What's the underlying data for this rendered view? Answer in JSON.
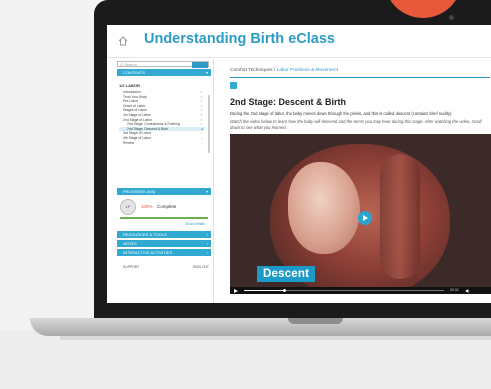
{
  "app": {
    "title": "Understanding Birth eClass"
  },
  "sidebar": {
    "search_placeholder": "Q Search",
    "sections": {
      "contents": "CONTENTS",
      "progress": "PROGRESS (5/8)",
      "resources": "RESOURCES & TOOLS",
      "notes": "NOTES",
      "interactive": "INTERACTIVE ACTIVITIES"
    },
    "toc_head": "1/2 LABOR",
    "toc": [
      {
        "label": "Introduction",
        "sub": false,
        "done": true,
        "active": false
      },
      {
        "label": "Trust Your Body",
        "sub": false,
        "done": true,
        "active": false
      },
      {
        "label": "Pre-Labor",
        "sub": false,
        "done": true,
        "active": false
      },
      {
        "label": "Onset of Labor",
        "sub": false,
        "done": true,
        "active": false
      },
      {
        "label": "Stages of Labor",
        "sub": false,
        "done": true,
        "active": false
      },
      {
        "label": "1st Stage of Labor",
        "sub": false,
        "done": true,
        "active": false
      },
      {
        "label": "2nd Stage of Labor",
        "sub": false,
        "done": true,
        "active": false
      },
      {
        "label": "2nd Stage: Contractions & Pushing",
        "sub": true,
        "done": true,
        "active": false
      },
      {
        "label": "2nd Stage: Descent & Birth",
        "sub": true,
        "done": false,
        "active": true
      },
      {
        "label": "3rd Stage of Labor",
        "sub": false,
        "done": false,
        "active": false
      },
      {
        "label": "4th Stage of Labor",
        "sub": false,
        "done": false,
        "active": false
      },
      {
        "label": "Review",
        "sub": false,
        "done": false,
        "active": false
      }
    ],
    "progress": {
      "avatar": "LF",
      "percent_text": "100%",
      "status": "Complete",
      "fraction": 1.0,
      "show_details": "Show Details"
    },
    "footer": {
      "support": "SUPPORT",
      "signout": "SIGN OUT"
    }
  },
  "main": {
    "breadcrumb_root": "Comfort Techniques",
    "breadcrumb_sep": " / ",
    "breadcrumb_current": "Labor Positions & Movement",
    "lesson_title": "2nd Stage: Descent & Birth",
    "lesson_text": "During the 2nd stage of labor, the baby moves down through the pelvis, and this is called descent (contains brief nudity).",
    "lesson_instructions": "Watch the video below to learn how the baby will descend and the terms you may hear during this stage. After watching the video, scroll down to see what you learned.",
    "video": {
      "caption": "Descent",
      "time": "00:32",
      "progress": 0.2
    }
  },
  "colors": {
    "accent": "#2d9bc5",
    "sidebar_header": "#31a9d2",
    "progress_green": "#6ab04c",
    "orange_shape": "#e8593c"
  }
}
